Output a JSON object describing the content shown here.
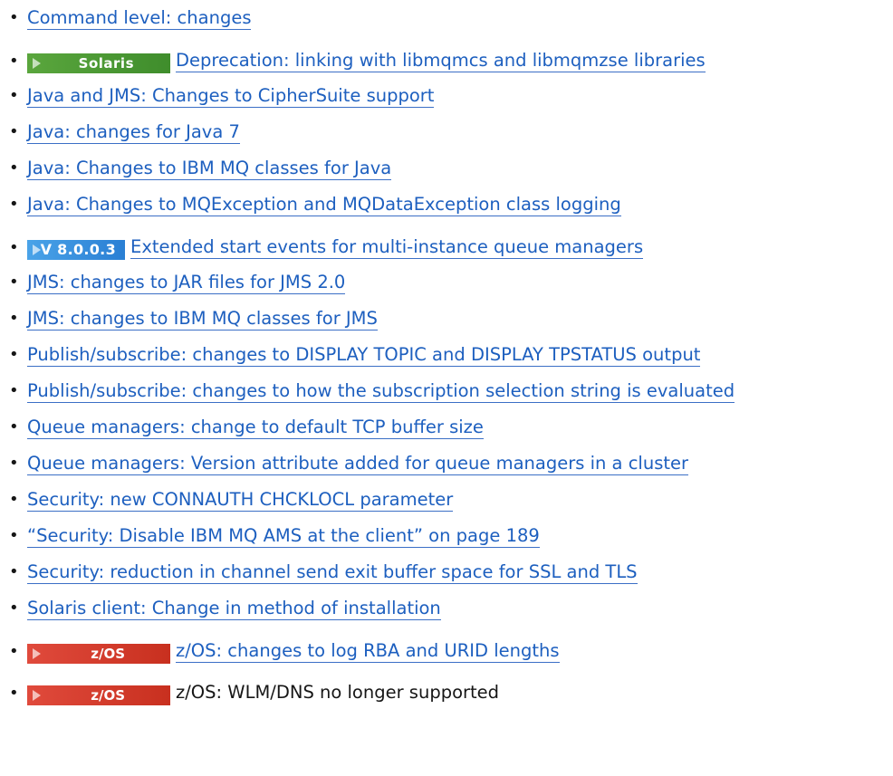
{
  "items": [
    {
      "text": "Command level: changes"
    },
    {
      "badge": "Solaris",
      "badge_icon": "arrow-right-icon",
      "text": "Deprecation: linking with libmqmcs and libmqmzse libraries"
    },
    {
      "text": "Java and JMS: Changes to CipherSuite support"
    },
    {
      "text": "Java: changes for Java 7"
    },
    {
      "text": "Java: Changes to IBM MQ classes for Java"
    },
    {
      "text": "Java: Changes to MQException and MQDataException class logging"
    },
    {
      "badge": "V 8.0.0.3",
      "badge_icon": "arrow-right-icon",
      "text": "Extended start events for multi-instance queue managers"
    },
    {
      "text": "JMS: changes to JAR files for JMS 2.0"
    },
    {
      "text": "JMS: changes to IBM MQ classes for JMS"
    },
    {
      "text": "Publish/subscribe: changes to DISPLAY TOPIC and DISPLAY TPSTATUS output"
    },
    {
      "text": "Publish/subscribe: changes to how the subscription selection string is evaluated"
    },
    {
      "text": "Queue managers: change to default TCP buffer size"
    },
    {
      "text": "Queue managers: Version attribute added for queue managers in a cluster"
    },
    {
      "text": "Security: new CONNAUTH CHCKLOCL parameter"
    },
    {
      "text": "“Security: Disable IBM MQ AMS at the client” on page 189"
    },
    {
      "text": "Security: reduction in channel send exit buffer space for SSL and TLS"
    },
    {
      "text": "Solaris client: Change in method of installation"
    },
    {
      "badge": "z/OS",
      "badge_icon": "arrow-right-icon",
      "text": "z/OS: changes to log RBA and URID lengths"
    },
    {
      "badge": "z/OS",
      "badge_icon": "arrow-right-icon",
      "text": "z/OS: WLM/DNS no longer supported"
    }
  ],
  "bullet_char": "•",
  "colors": {
    "link": "#1d5fbf",
    "solaris_badge": "#4f9c3a",
    "version_badge": "#2a7fd4",
    "zos_badge": "#c8301f"
  }
}
